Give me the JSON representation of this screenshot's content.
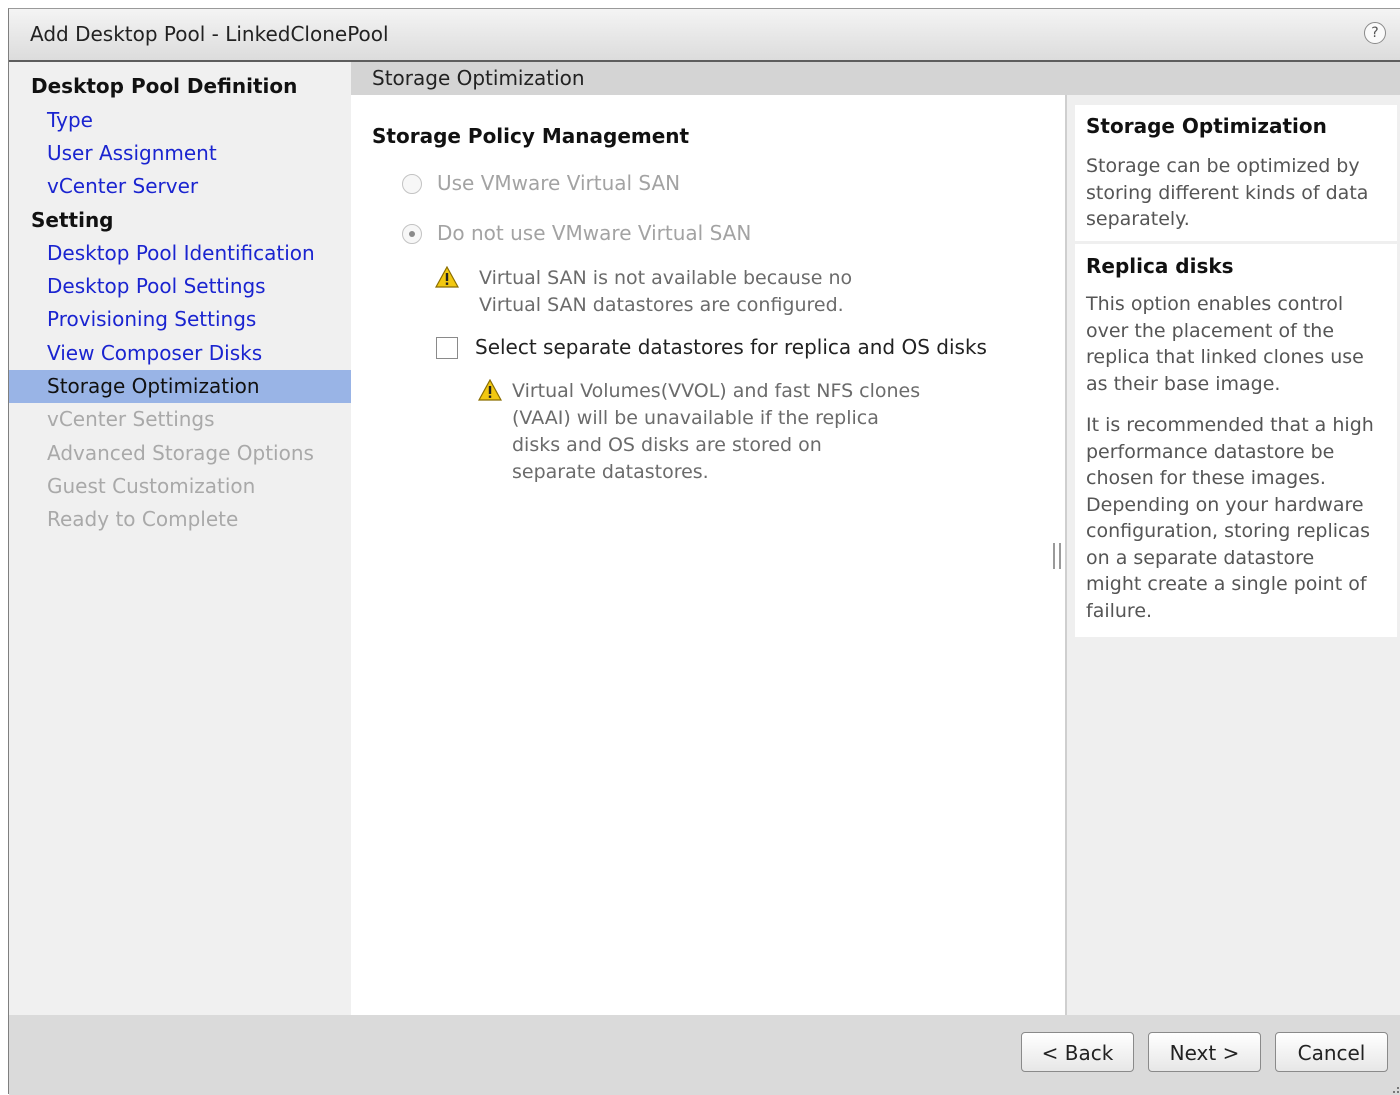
{
  "window": {
    "title": "Add Desktop Pool - LinkedClonePool",
    "help_icon": "?"
  },
  "nav": {
    "sections": [
      {
        "label": "Desktop Pool Definition"
      },
      {
        "label": "Setting"
      }
    ],
    "items": [
      {
        "label": "Type",
        "state": "link"
      },
      {
        "label": "User Assignment",
        "state": "link"
      },
      {
        "label": "vCenter Server",
        "state": "link"
      },
      {
        "label": "Desktop Pool Identification",
        "state": "link"
      },
      {
        "label": "Desktop Pool Settings",
        "state": "link"
      },
      {
        "label": "Provisioning Settings",
        "state": "link"
      },
      {
        "label": "View Composer Disks",
        "state": "link"
      },
      {
        "label": "Storage Optimization",
        "state": "active"
      },
      {
        "label": "vCenter Settings",
        "state": "disabled"
      },
      {
        "label": "Advanced Storage Options",
        "state": "disabled"
      },
      {
        "label": "Guest Customization",
        "state": "disabled"
      },
      {
        "label": "Ready to Complete",
        "state": "disabled"
      }
    ]
  },
  "content": {
    "header": "Storage Optimization",
    "section_title": "Storage Policy Management",
    "radio_options": [
      {
        "label": "Use VMware Virtual SAN",
        "selected": false
      },
      {
        "label": "Do not use VMware Virtual SAN",
        "selected": true
      }
    ],
    "vsan_warning": [
      "Virtual SAN is not available because no",
      "Virtual SAN datastores are configured."
    ],
    "checkbox_label": "Select separate datastores for replica and OS disks",
    "checkbox_checked": false,
    "vvol_warning": [
      "Virtual Volumes(VVOL) and fast NFS clones",
      "(VAAI) will be unavailable if the replica",
      "disks and OS disks are stored on",
      "separate datastores."
    ]
  },
  "help": {
    "title": "Storage Optimization",
    "intro": [
      "Storage can be optimized by",
      "storing different kinds of data",
      "separately."
    ],
    "replica_title": "Replica disks",
    "replica_p1": [
      "This option enables control",
      "over the placement of the",
      "replica that linked clones use",
      "as their base image."
    ],
    "replica_p2": [
      "It is recommended that a high",
      "performance datastore be",
      "chosen for these images.",
      "Depending on your hardware",
      "configuration, storing replicas",
      "on a separate datastore",
      "might create a single point of",
      "failure."
    ]
  },
  "footer": {
    "back_label": "< Back",
    "next_label": "Next >",
    "cancel_label": "Cancel"
  },
  "colors": {
    "link": "#1a24d0",
    "active_bg": "#99b4e6",
    "disabled": "#a9a9a9",
    "warning": "#f2c811"
  }
}
